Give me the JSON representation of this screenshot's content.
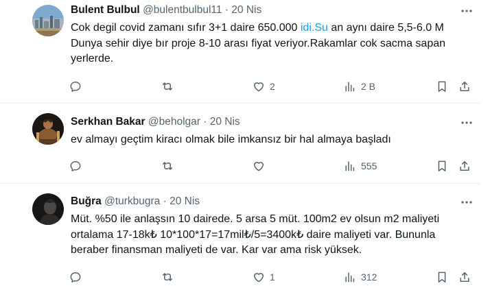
{
  "colors": {
    "text": "#0f1419",
    "secondary": "#536471",
    "link": "#1d9bf0",
    "divider": "#e9ecee"
  },
  "tweets": [
    {
      "name": "Bulent Bulbul",
      "handle": "@bulentbulbul11",
      "date": "20 Nis",
      "text_before": "Cok degil covid zamanı sıfır 3+1 daire 650.000 ",
      "link": "idi.Su",
      "text_after": " an aynı daire 5,5-6.0 M Dunya sehir diye bır proje 8-10 arası fiyat veriyor.Rakamlar cok sacma sapan yerlerde.",
      "replies": "",
      "retweets": "",
      "likes": "2",
      "views": "2 B",
      "avatar_icon": "city-skyline-avatar"
    },
    {
      "name": "Serkhan Bakar",
      "handle": "@beholgar",
      "date": "20 Nis",
      "text": "ev almayı geçtim kiracı olmak bile imkansız bir hal almaya başladı",
      "replies": "",
      "retweets": "",
      "likes": "",
      "views": "555",
      "avatar_icon": "warrior-avatar"
    },
    {
      "name": "Buğra",
      "handle": "@turkbugra",
      "date": "20 Nis",
      "text": "Müt. %50 ile anlaşsın 10 dairede. 5 arsa 5 müt. 100m2 ev olsun m2 maliyeti ortalama 17-18k₺ 10*100*17=17mil₺/5=3400k₺ daire maliyeti var. Bununla beraber finansman maliyeti de var. Kar var ama risk yüksek.",
      "replies": "",
      "retweets": "",
      "likes": "1",
      "views": "312",
      "avatar_icon": "dark-portrait-avatar"
    }
  ],
  "separator": "·",
  "icons": [
    "reply-icon",
    "retweet-icon",
    "like-icon",
    "views-icon",
    "bookmark-icon",
    "share-icon",
    "more-icon"
  ]
}
